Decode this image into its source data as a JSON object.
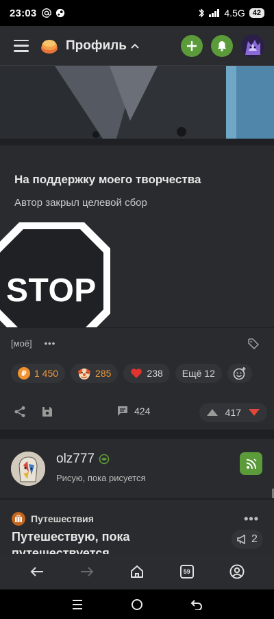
{
  "status_bar": {
    "time": "23:03",
    "network": "4.5G",
    "battery": "42"
  },
  "header": {
    "title": "Профиль"
  },
  "donation": {
    "title": "На поддержку моего творчества",
    "subtitle": "Автор закрыл целевой сбор"
  },
  "stop_sign": {
    "text": "STOP"
  },
  "post_meta": {
    "tag": "[моё]",
    "more": "•••"
  },
  "reactions": {
    "donations": "1 450",
    "clown": "285",
    "likes": "238",
    "more_label": "Ещё 12"
  },
  "actions": {
    "comments": "424",
    "rating": "417"
  },
  "author": {
    "name": "olz777",
    "subtitle": "Рисую, пока рисуется"
  },
  "next_post": {
    "community": "Путешествия",
    "title": "Путешествую, пока путешествуется",
    "more": "•••",
    "promo_count": "2"
  },
  "bottom_nav": {
    "tabs_count": "59"
  },
  "colors": {
    "accent_green": "#5c9b3a",
    "coin_orange": "#f0922f",
    "dislike_red": "#e0463a",
    "background": "#1f2023",
    "card": "#2a2b2e"
  }
}
